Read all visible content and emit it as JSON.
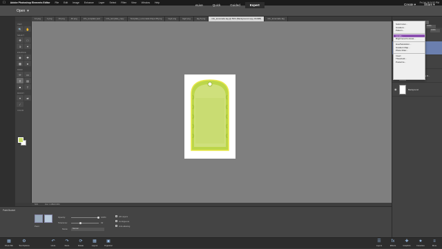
{
  "menubar": {
    "app_name": "Adobe Photoshop Elements Editor",
    "items": [
      "File",
      "Edit",
      "Image",
      "Enhance",
      "Layer",
      "Select",
      "Filter",
      "View",
      "Window",
      "Help"
    ],
    "clock": "Fri Jul 16 5:32 PM"
  },
  "header": {
    "open_label": "Open",
    "modes": [
      "eLive",
      "Quick",
      "Guided",
      "Expert"
    ],
    "active_mode": "Expert",
    "create_label": "Create",
    "share_label": "Share"
  },
  "tabs": [
    {
      "label": "11.png",
      "active": false
    },
    {
      "label": "1.png",
      "active": false
    },
    {
      "label": "10.png",
      "active": false
    },
    {
      "label": "40.png",
      "active": false
    },
    {
      "label": "info_template.psd",
      "active": false
    },
    {
      "label": "info_template_copy",
      "active": false
    },
    {
      "label": "Template_Lemonade Rays-08.png",
      "active": false
    },
    {
      "label": "tag1.png",
      "active": false
    },
    {
      "label": "tag2.png",
      "active": false
    },
    {
      "label": "tag 6.png",
      "active": false
    },
    {
      "label": "info_lemonade.tag @ 50% (Background copy, RGB/8)",
      "active": true
    },
    {
      "label": "info_lemonade.tag",
      "active": false
    }
  ],
  "toolbox": {
    "sections": [
      "VIEW",
      "SELECT",
      "ENHANCE",
      "DRAW",
      "MODIFY",
      "COLOR"
    ],
    "view_tools": [
      "search-icon",
      "hand-icon"
    ],
    "select_tools": [
      "move-icon",
      "marquee-icon",
      "lasso-icon",
      "wand-icon"
    ],
    "enhance_tools": [
      "eye-icon",
      "spot-icon",
      "sponge-icon",
      "blur-icon"
    ],
    "draw_tools": [
      "brush-icon",
      "eraser-icon",
      "bucket-icon",
      "gradient-icon",
      "shape-icon",
      "text-icon"
    ],
    "modify_tools": [
      "crop-icon",
      "recompose-icon",
      "straighten-icon"
    ],
    "fg_color": "#c8dc6c",
    "bg_color": "#ffffff"
  },
  "status": {
    "zoom": "50%",
    "doc": "Doc: 4.18M/4.04M"
  },
  "layers_panel": {
    "mode": "Normal",
    "opacity": "100%",
    "layers": [
      {
        "name": "Background copy",
        "selected": true,
        "thumb": "white"
      },
      {
        "name": "Template_Lemo...",
        "selected": false,
        "thumb": "green"
      },
      {
        "name": "Template_Lemonade R...",
        "selected": false,
        "thumb": "green"
      },
      {
        "name": "Background",
        "selected": false,
        "thumb": "white"
      }
    ]
  },
  "dropdown": {
    "groups": [
      [
        "Solid Color...",
        "Gradient...",
        "Pattern..."
      ],
      [
        "Levels...",
        "Brightness/Contrast..."
      ],
      [
        "Hue/Saturation...",
        "Gradient Map...",
        "Photo Filter..."
      ],
      [
        "Invert",
        "Threshold...",
        "Posterize..."
      ]
    ],
    "highlighted": "Levels..."
  },
  "tool_options": {
    "title": "Paint Bucket",
    "fill_label": "Paint",
    "opacity_label": "Opacity:",
    "opacity_value": "100%",
    "tolerance_label": "Tolerance:",
    "tolerance_value": "32",
    "mode_label": "Mode:",
    "mode_value": "Normal",
    "checks": [
      "All Layers",
      "Contiguous",
      "Anti-aliasing"
    ]
  },
  "taskbar": {
    "left": [
      "Photo Bin",
      "Tool Options",
      "Undo",
      "Redo",
      "Rotate",
      "Layout",
      "Organizer"
    ],
    "right": [
      "Layers",
      "Effects",
      "Graphics",
      "Favorites",
      "More"
    ]
  }
}
